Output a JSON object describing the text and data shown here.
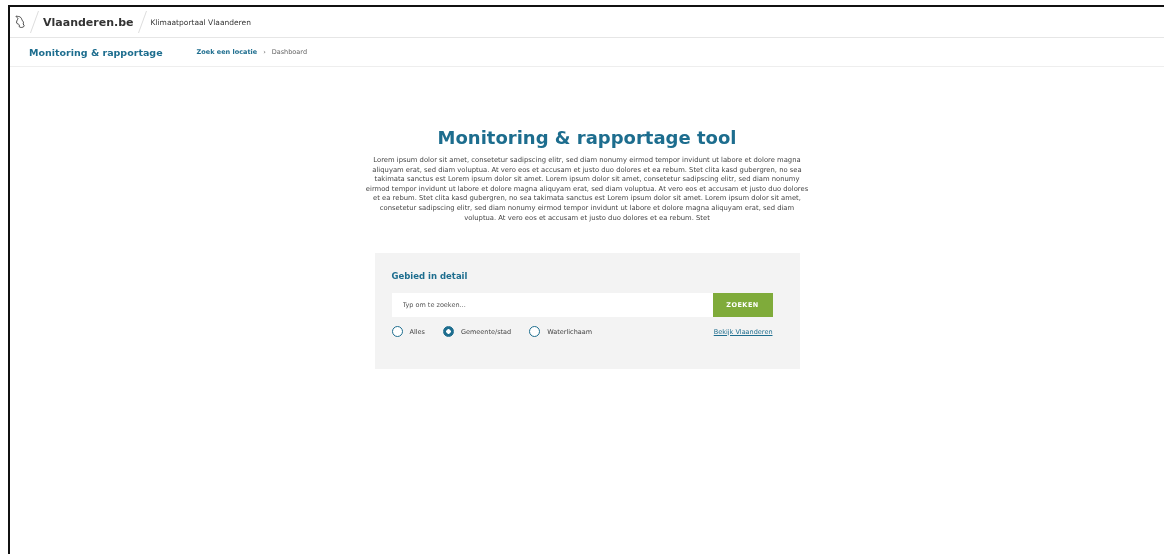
{
  "header": {
    "brand": "Vlaanderen.be",
    "site": "Klimaatportaal Vlaanderen"
  },
  "subnav": {
    "title": "Monitoring & rapportage",
    "breadcrumb": [
      {
        "label": "Zoek een locatie",
        "link": true
      },
      {
        "label": "Dashboard",
        "link": false
      }
    ],
    "separator": "›"
  },
  "main": {
    "title": "Monitoring & rapportage tool",
    "intro": "Lorem ipsum dolor sit amet, consetetur sadipscing elitr, sed diam nonumy eirmod tempor invidunt ut labore et dolore magna aliquyam erat, sed diam voluptua. At vero eos et accusam et justo duo dolores et ea rebum. Stet clita kasd gubergren, no sea takimata sanctus est Lorem ipsum dolor sit amet. Lorem ipsum dolor sit amet, consetetur sadipscing elitr, sed diam nonumy eirmod tempor invidunt ut labore et dolore magna aliquyam erat, sed diam voluptua. At vero eos et accusam et justo duo dolores et ea rebum. Stet clita kasd gubergren, no sea takimata sanctus est Lorem ipsum dolor sit amet. Lorem ipsum dolor sit amet, consetetur sadipscing elitr, sed diam nonumy eirmod tempor invidunt ut labore et dolore magna aliquyam erat, sed diam voluptua. At vero eos et accusam et justo duo dolores et ea rebum. Stet"
  },
  "search_card": {
    "title": "Gebied in detail",
    "placeholder": "Typ om te zoeken...",
    "button": "ZOEKEN",
    "options": [
      {
        "label": "Alles",
        "selected": false
      },
      {
        "label": "Gemeente/stad",
        "selected": true
      },
      {
        "label": "Waterlichaam",
        "selected": false
      }
    ],
    "link": "Bekijk Vlaanderen"
  }
}
